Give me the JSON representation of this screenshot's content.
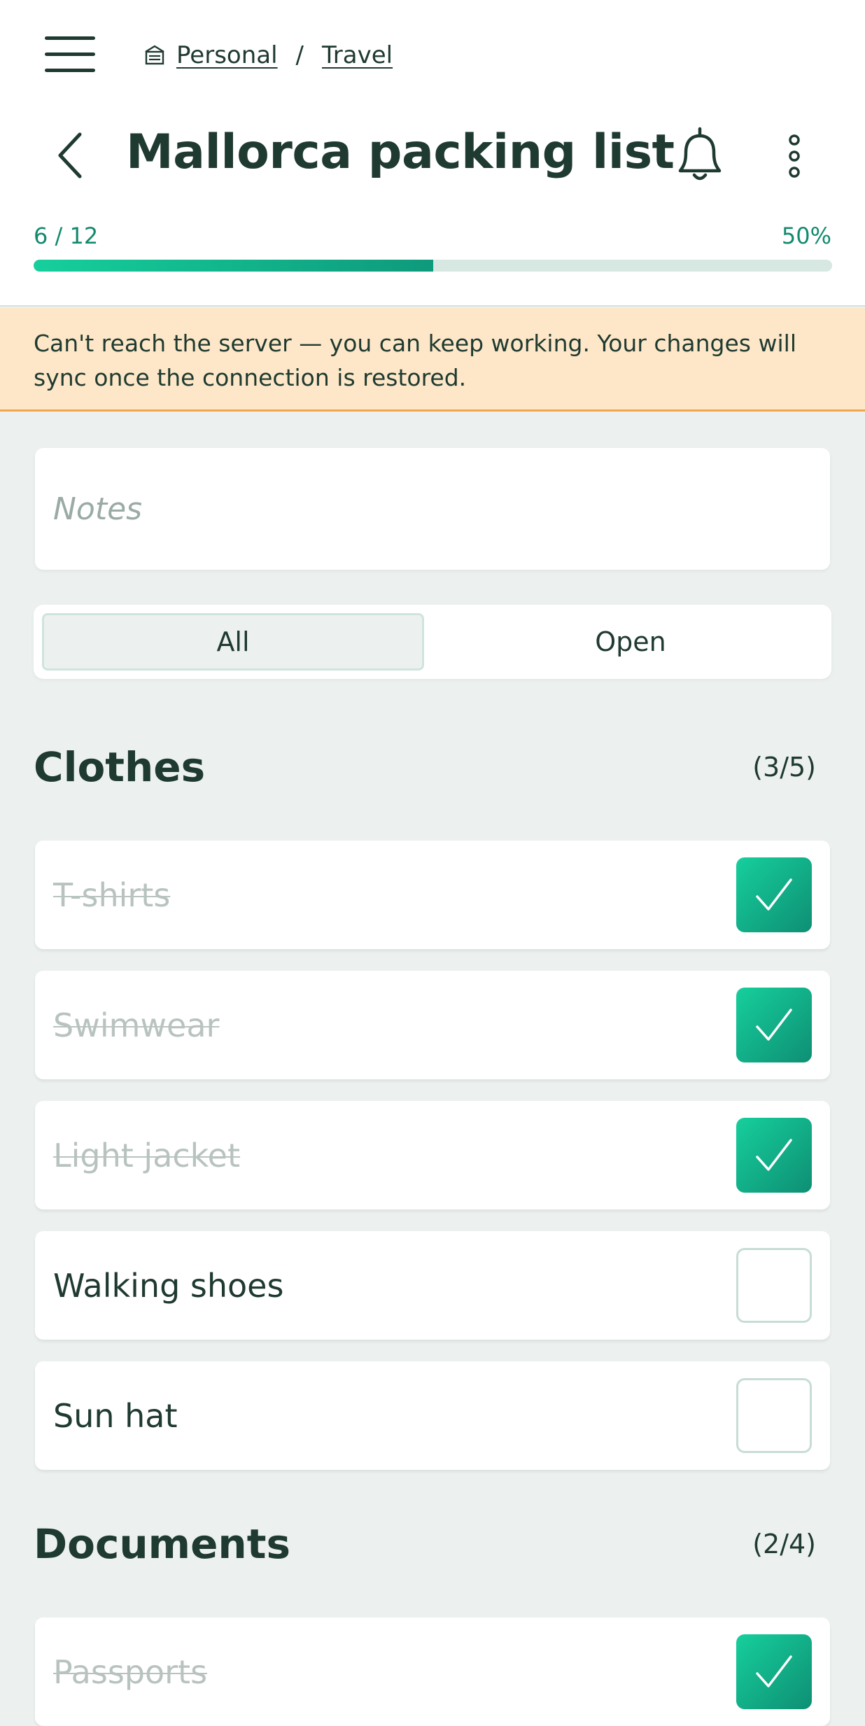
{
  "breadcrumb": {
    "items": [
      "Personal",
      "Travel"
    ],
    "separator": "/"
  },
  "header": {
    "title": "Mallorca packing list"
  },
  "progress": {
    "count_text": "6 / 12",
    "percent_text": "50%",
    "fraction": 0.5
  },
  "banner": {
    "text": "Can't reach the server — you can keep working. Your changes will sync once the connection is restored."
  },
  "notes": {
    "placeholder": "Notes",
    "value": ""
  },
  "filter": {
    "all_label": "All",
    "open_label": "Open",
    "selected": "All"
  },
  "sections": [
    {
      "title": "Clothes",
      "count": "(3/5)",
      "items": [
        {
          "label": "T-shirts",
          "checked": true
        },
        {
          "label": "Swimwear",
          "checked": true
        },
        {
          "label": "Light jacket",
          "checked": true
        },
        {
          "label": "Walking shoes",
          "checked": false
        },
        {
          "label": "Sun hat",
          "checked": false
        }
      ]
    },
    {
      "title": "Documents",
      "count": "(2/4)",
      "items": [
        {
          "label": "Passports",
          "checked": true
        }
      ]
    }
  ],
  "colors": {
    "accent": "#16cf9c",
    "accent_dark": "#0e8f74",
    "text": "#1f3a30",
    "banner_bg": "#fde7c8",
    "banner_border": "#f0a64a",
    "page_bg": "#ecf1ef"
  }
}
